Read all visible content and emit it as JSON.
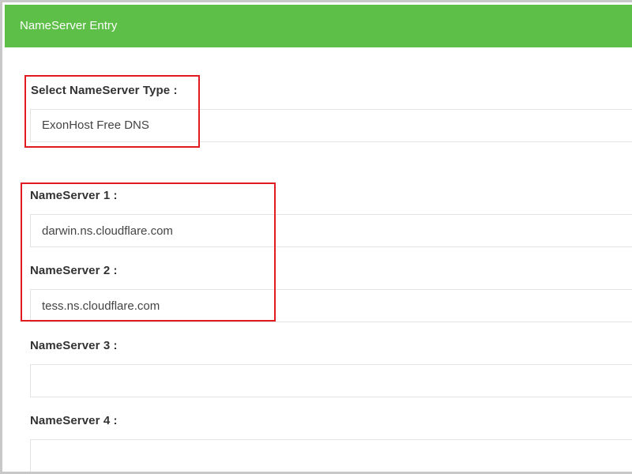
{
  "panel": {
    "title": "NameServer Entry"
  },
  "nameserver_type": {
    "label": "Select NameServer Type :",
    "selected": "ExonHost Free DNS"
  },
  "nameservers": [
    {
      "label": "NameServer 1 :",
      "value": "darwin.ns.cloudflare.com"
    },
    {
      "label": "NameServer 2 :",
      "value": "tess.ns.cloudflare.com"
    },
    {
      "label": "NameServer 3 :",
      "value": ""
    },
    {
      "label": "NameServer 4 :",
      "value": ""
    }
  ],
  "colors": {
    "header_green": "#5dbf47",
    "highlight_red": "#e21a22"
  }
}
